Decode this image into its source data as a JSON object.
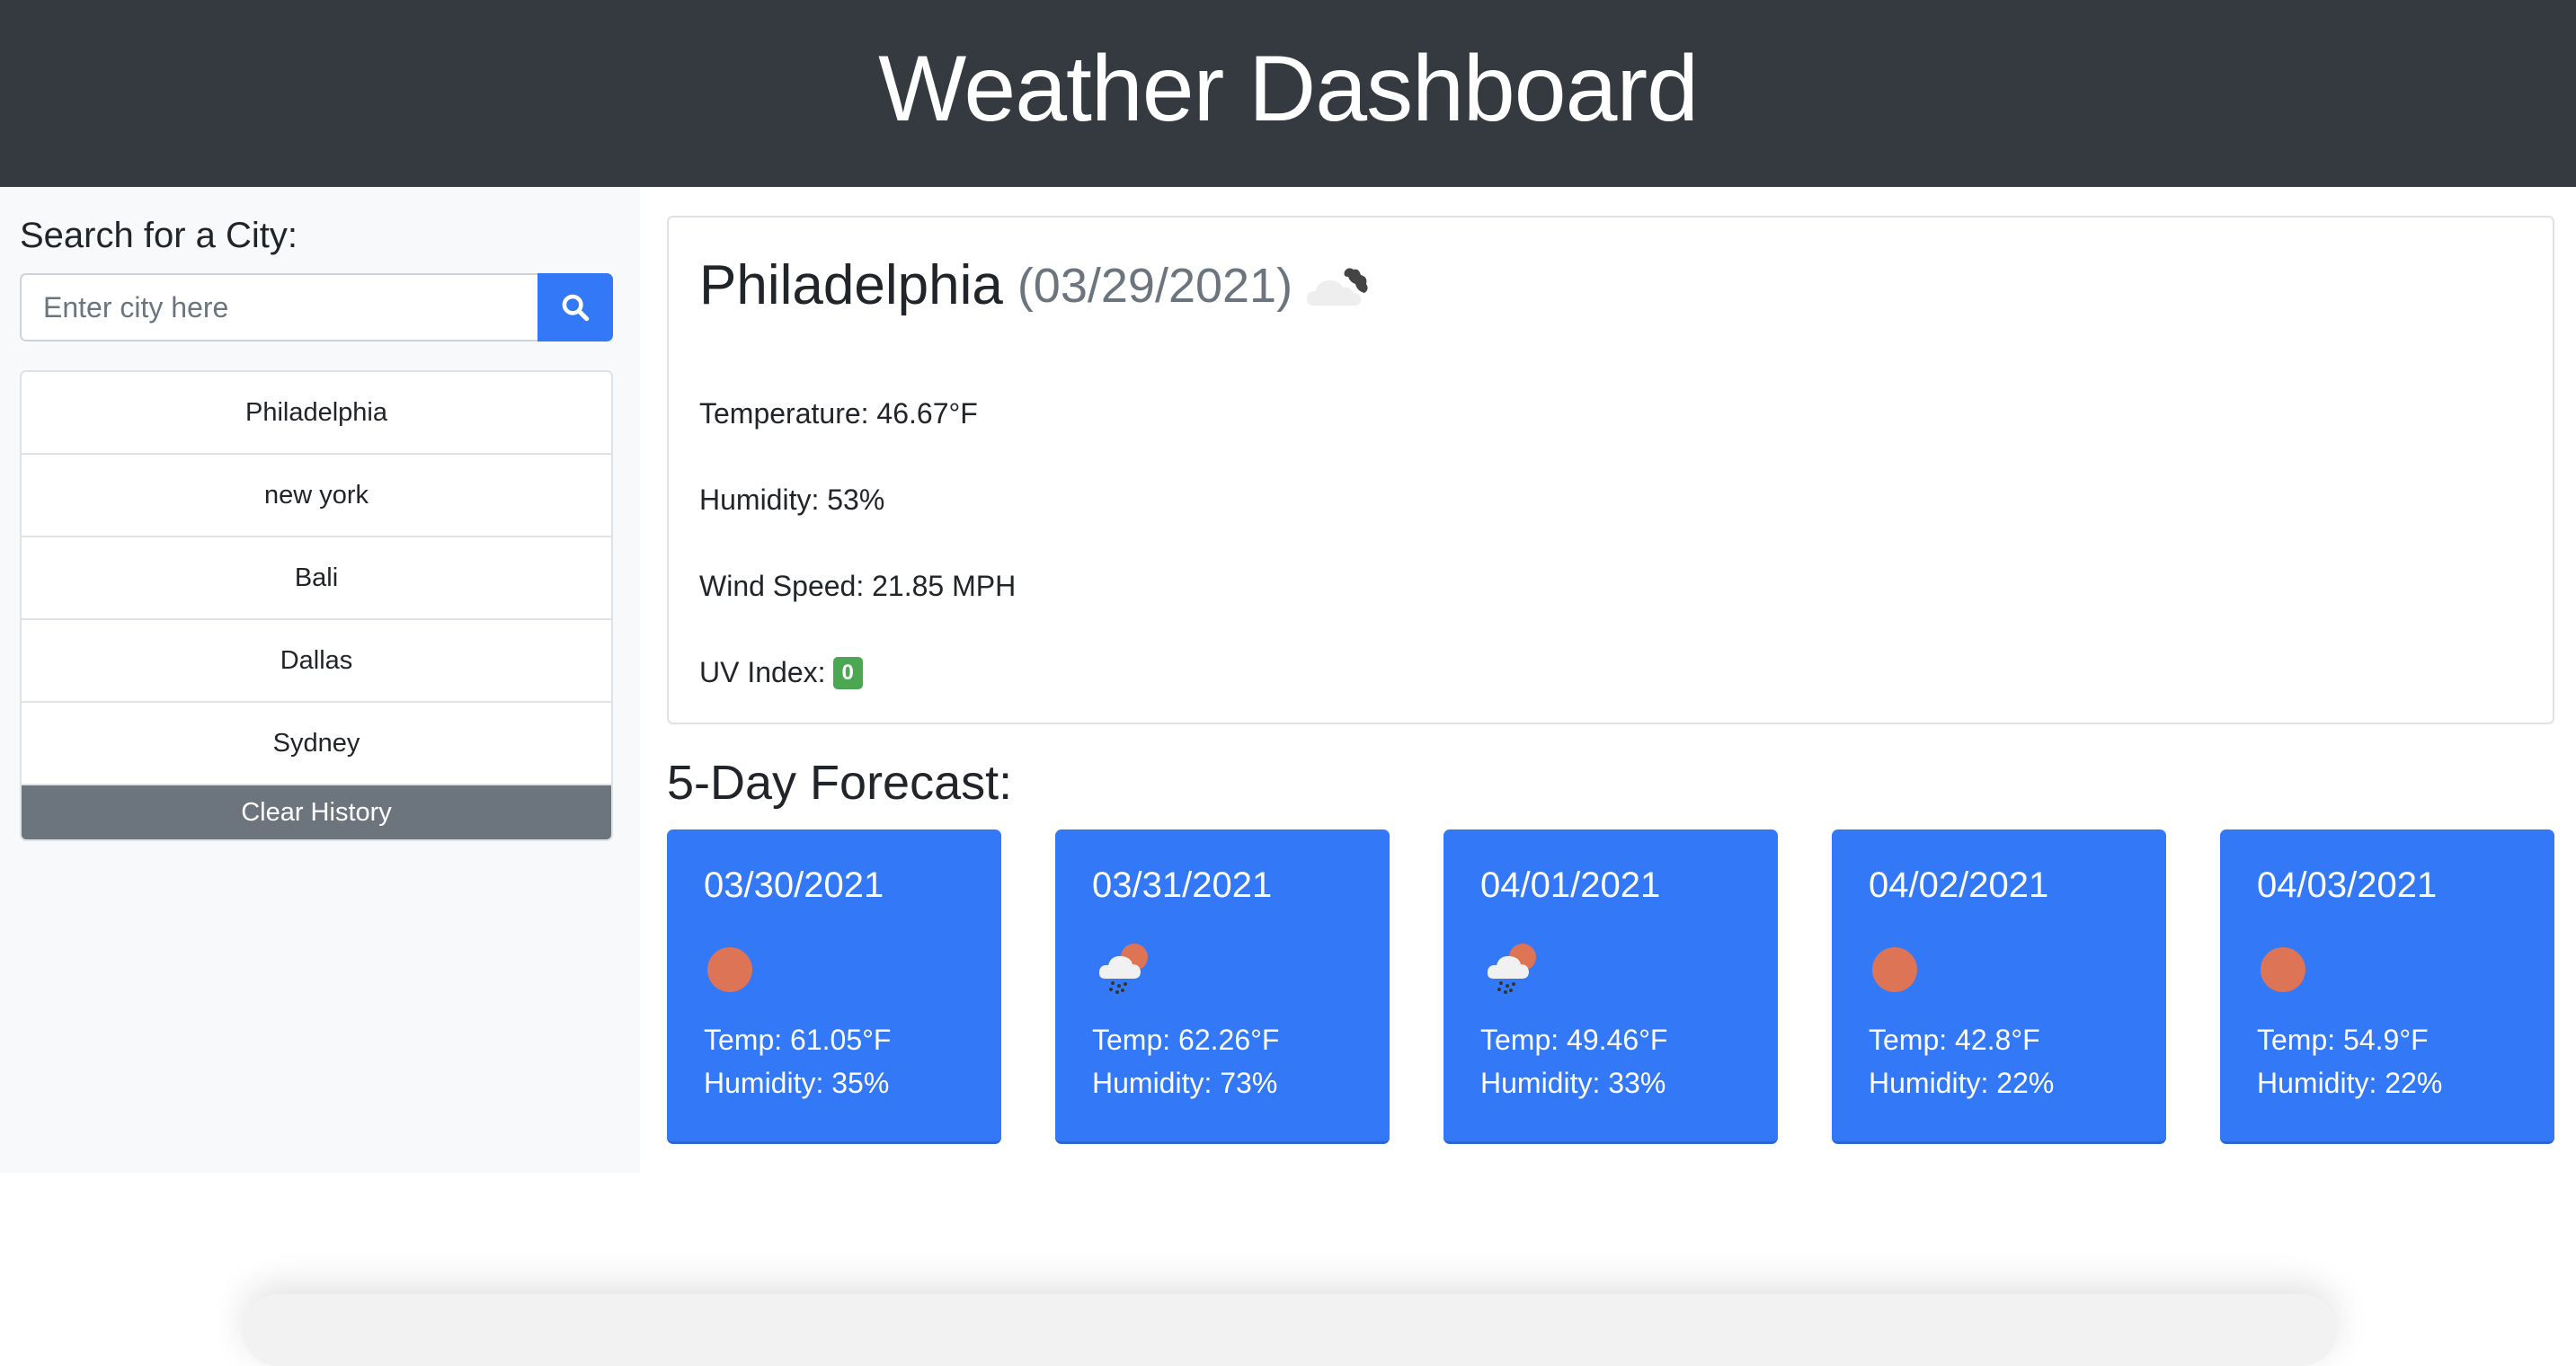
{
  "header": {
    "title": "Weather Dashboard"
  },
  "sidebar": {
    "title": "Search for a City:",
    "search": {
      "placeholder": "Enter city here",
      "value": "",
      "button_icon": "search-icon"
    },
    "history": [
      "Philadelphia",
      "new york",
      "Bali",
      "Dallas",
      "Sydney"
    ],
    "clear_label": "Clear History"
  },
  "current": {
    "city": "Philadelphia",
    "date": "(03/29/2021)",
    "icon": "cloudy-icon",
    "temperature": "Temperature: 46.67°F",
    "humidity": "Humidity: 53%",
    "wind": "Wind Speed: 21.85 MPH",
    "uv_label": "UV Index:",
    "uv_value": "0",
    "uv_color": "#4ca752"
  },
  "forecast": {
    "title": "5-Day Forecast:",
    "days": [
      {
        "date": "03/30/2021",
        "icon": "sun-icon",
        "temp": "Temp: 61.05°F",
        "humidity": "Humidity: 35%"
      },
      {
        "date": "03/31/2021",
        "icon": "rain-sun-icon",
        "temp": "Temp: 62.26°F",
        "humidity": "Humidity: 73%"
      },
      {
        "date": "04/01/2021",
        "icon": "rain-sun-icon",
        "temp": "Temp: 49.46°F",
        "humidity": "Humidity: 33%"
      },
      {
        "date": "04/02/2021",
        "icon": "sun-icon",
        "temp": "Temp: 42.8°F",
        "humidity": "Humidity: 22%"
      },
      {
        "date": "04/03/2021",
        "icon": "sun-icon",
        "temp": "Temp: 54.9°F",
        "humidity": "Humidity: 22%"
      }
    ]
  },
  "colors": {
    "header_bg": "#343a40",
    "accent": "#3378f6",
    "secondary": "#6c757d",
    "sun": "#dd7455"
  }
}
